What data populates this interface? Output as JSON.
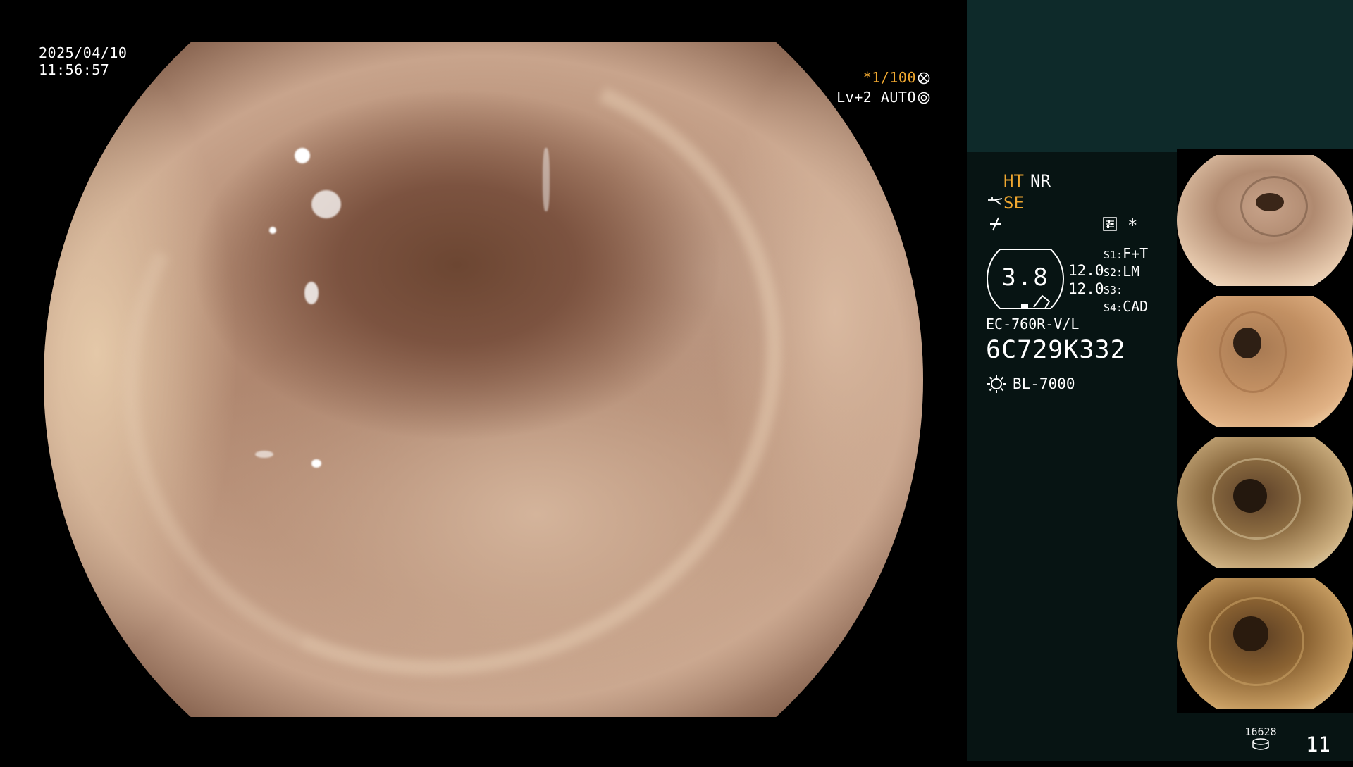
{
  "overlay": {
    "date": "2025/04/10",
    "time": "11:56:57",
    "shutter": "*1/100",
    "shutter_icon": "shutter-dial-icon",
    "iris_level": "Lv+2",
    "iris_mode": "AUTO",
    "iris_icon": "iris-icon"
  },
  "status": {
    "ht": "HT",
    "nr": "NR",
    "se": "SE",
    "se_icon": "scissor-electrode-icon",
    "freeze_icon": "freeze-icon",
    "settings_icon": "menu-settings-icon",
    "asterisk": "*"
  },
  "meter": {
    "value": "3.8",
    "v1": "12.0",
    "v2": "12.0"
  },
  "switches": [
    {
      "label": "S1:",
      "value": "F+T"
    },
    {
      "label": "S2:",
      "value": "LM"
    },
    {
      "label": "S3:",
      "value": ""
    },
    {
      "label": "S4:",
      "value": "CAD"
    }
  ],
  "scope": {
    "model": "EC-760R-V/L",
    "serial": "6C729K332",
    "light_source": "BL-7000",
    "light_icon": "light-source-icon"
  },
  "footer": {
    "count": "16628",
    "storage_icon": "storage-icon",
    "page": "11"
  },
  "colors": {
    "accent_orange": "#f0a830",
    "panel_dark": "#071413",
    "panel_top": "#0e2a2a"
  }
}
